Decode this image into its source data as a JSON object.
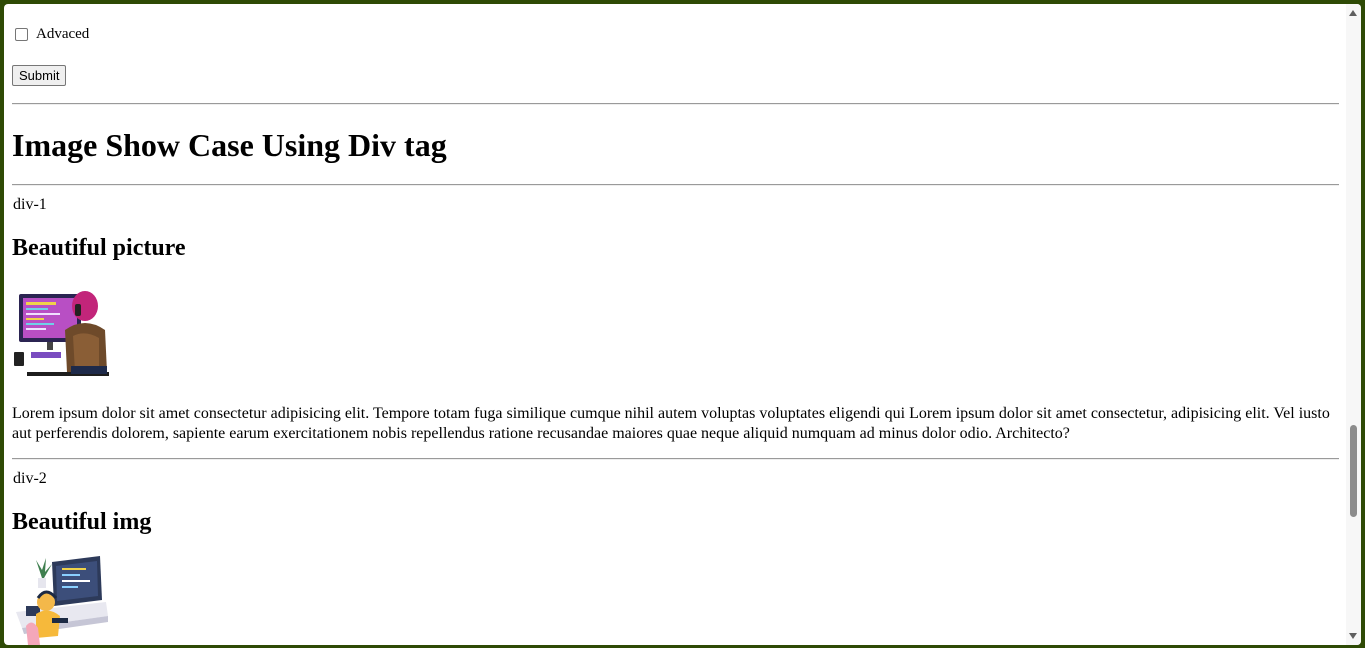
{
  "form": {
    "advanced_label": "Advaced",
    "submit_label": "Submit"
  },
  "page": {
    "heading": "Image Show Case Using Div tag"
  },
  "div1": {
    "label": "div-1",
    "title": "Beautiful picture",
    "image_name": "coder-at-monitor-illustration",
    "text": "Lorem ipsum dolor sit amet consectetur adipisicing elit. Tempore totam fuga similique cumque nihil autem voluptas voluptates eligendi qui Lorem ipsum dolor sit amet consectetur, adipisicing elit. Vel iusto aut perferendis dolorem, sapiente earum exercitationem nobis repellendus ratione recusandae maiores quae neque aliquid numquam ad minus dolor odio. Architecto?"
  },
  "div2": {
    "label": "div-2",
    "title": "Beautiful img",
    "image_name": "developer-desk-illustration"
  },
  "colors": {
    "window_border": "#2e4a05",
    "background": "#ffffff",
    "scroll_thumb": "#8c8c8c"
  }
}
